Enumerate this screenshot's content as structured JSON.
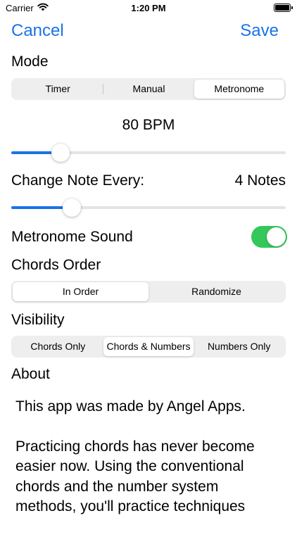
{
  "status": {
    "carrier": "Carrier",
    "time": "1:20 PM"
  },
  "nav": {
    "cancel_label": "Cancel",
    "save_label": "Save",
    "accent": "#1a73e8"
  },
  "mode": {
    "label": "Mode",
    "options": [
      "Timer",
      "Manual",
      "Metronome"
    ],
    "selected": "Metronome"
  },
  "bpm": {
    "label": "80 BPM",
    "slider_fraction": 0.18
  },
  "change_note": {
    "label": "Change Note Every:",
    "value": "4 Notes",
    "slider_fraction": 0.22
  },
  "metronome_sound": {
    "label": "Metronome Sound",
    "on": true,
    "toggle_color": "#34c759"
  },
  "chords_order": {
    "label": "Chords Order",
    "options": [
      "In Order",
      "Randomize"
    ],
    "selected": "In Order"
  },
  "visibility": {
    "label": "Visibility",
    "options": [
      "Chords Only",
      "Chords & Numbers",
      "Numbers Only"
    ],
    "selected": "Chords & Numbers"
  },
  "about": {
    "label": "About",
    "paragraphs": [
      "This app was made by Angel Apps.",
      "Practicing chords has never become easier now. Using the conventional chords and the number system methods, you'll practice techniques"
    ]
  }
}
